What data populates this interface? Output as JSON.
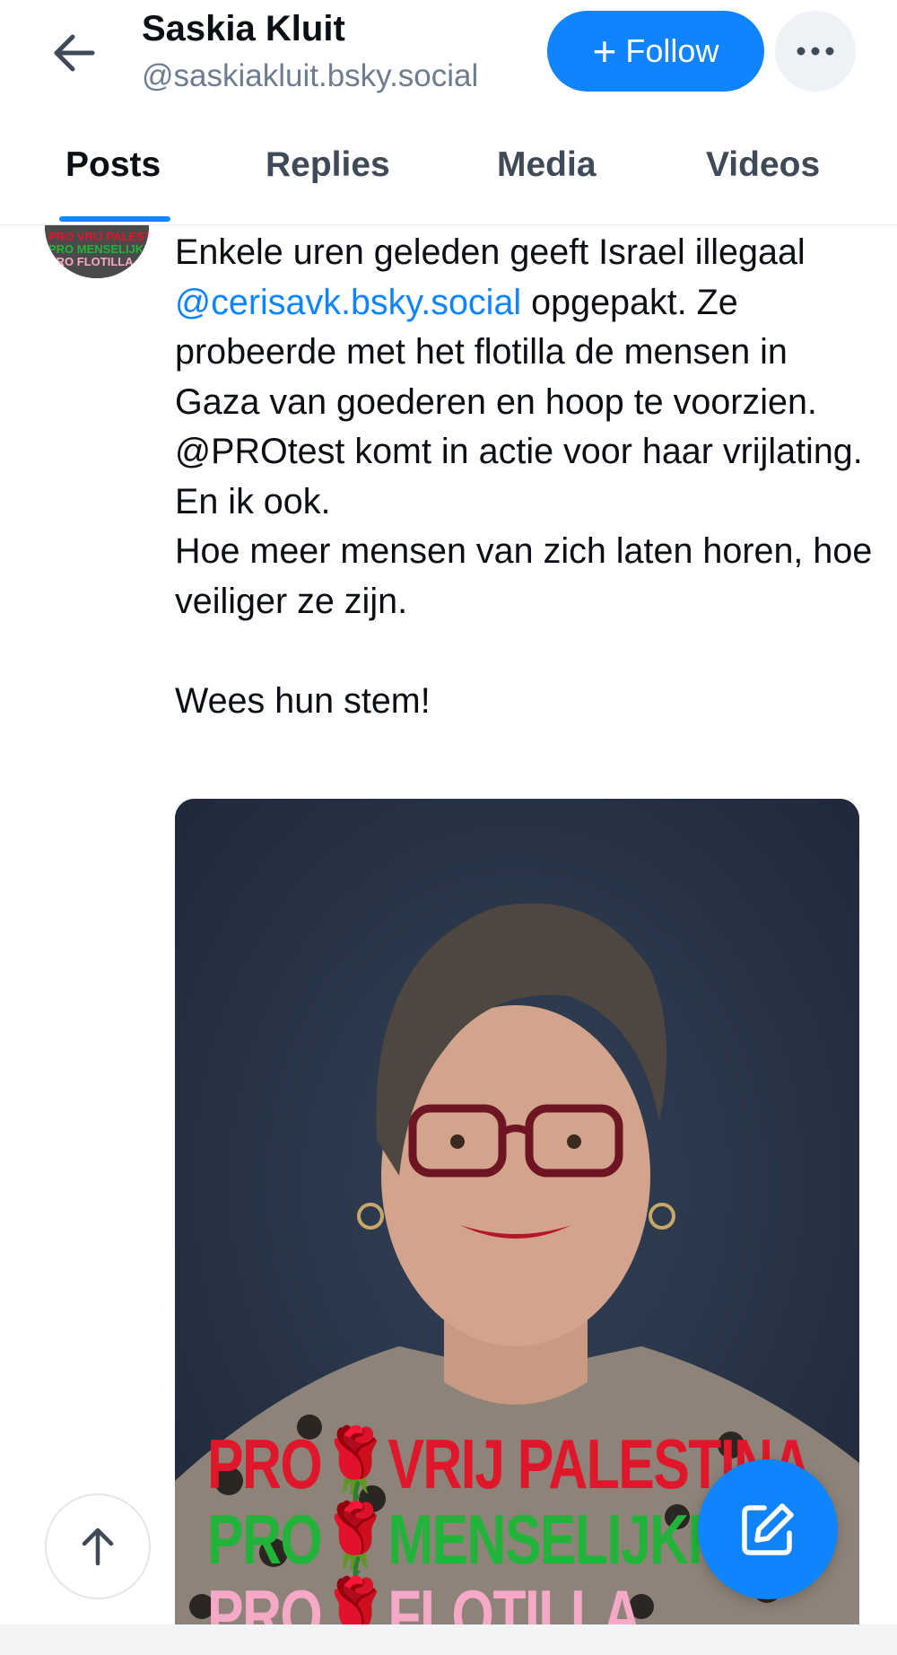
{
  "header": {
    "back_icon": "arrow-left-icon",
    "display_name": "Saskia Kluit",
    "handle": "@saskiakluit.bsky.social",
    "follow_label": "Follow",
    "follow_icon": "plus-icon",
    "more_icon": "ellipsis-icon"
  },
  "tabs": [
    {
      "label": "Posts",
      "active": true
    },
    {
      "label": "Replies",
      "active": false
    },
    {
      "label": "Media",
      "active": false
    },
    {
      "label": "Videos",
      "active": false
    }
  ],
  "post": {
    "text_before": "Enkele uren geleden geeft Israel illegaal ",
    "mention": "@cerisavk.bsky.social",
    "text_after": " opgepakt. Ze probeerde met het flotilla de mensen in Gaza van goederen en hoop te voorzien. @PROtest komt in actie voor haar vrijlating. En ik ook.\nHoe meer mensen van zich laten horen, hoe veiliger ze zijn.\n\nWees hun stem!",
    "image": {
      "overlay_line_1": "PRO🌹VRIJ PALESTINA",
      "overlay_line_2": "PRO🌹MENSELIJKHEID",
      "overlay_line_3": "PRO🌹FLOTILLA"
    },
    "avatar_text": "PRO VRIJ PALESTINA PRO MENSELIJKHEID PRO FLOTILLA"
  },
  "floating": {
    "scroll_top_icon": "arrow-up-icon",
    "compose_icon": "compose-icon"
  },
  "colors": {
    "accent": "#1083fe",
    "text": "#0b0f14",
    "muted": "#6d7d8f",
    "overlay_red": "#e0162b",
    "overlay_green": "#22b43a",
    "overlay_pink": "#f6a8c7"
  }
}
